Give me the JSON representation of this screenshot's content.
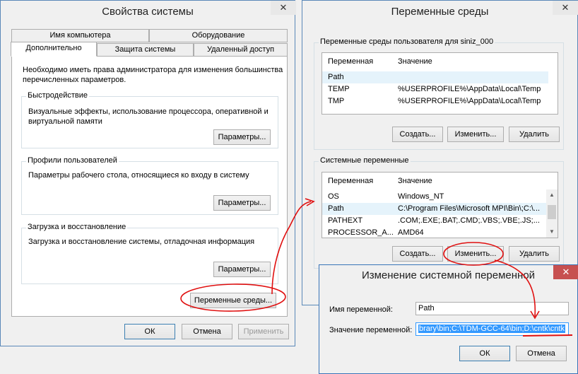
{
  "sysprops": {
    "title": "Свойства системы",
    "close_label": "✕",
    "tabs_row1": [
      "Имя компьютера",
      "Оборудование"
    ],
    "tabs_row2": [
      "Дополнительно",
      "Защита системы",
      "Удаленный доступ"
    ],
    "admin_note": "Необходимо иметь права администратора для изменения большинства перечисленных параметров.",
    "performance": {
      "title": "Быстродействие",
      "desc": "Визуальные эффекты, использование процессора, оперативной и виртуальной памяти",
      "button": "Параметры..."
    },
    "profiles": {
      "title": "Профили пользователей",
      "desc": "Параметры рабочего стола, относящиеся ко входу в систему",
      "button": "Параметры..."
    },
    "startup": {
      "title": "Загрузка и восстановление",
      "desc": "Загрузка и восстановление системы, отладочная информация",
      "button": "Параметры..."
    },
    "env_button": "Переменные среды...",
    "ok": "ОК",
    "cancel": "Отмена",
    "apply": "Применить"
  },
  "envvars": {
    "title": "Переменные среды",
    "close_label": "✕",
    "user_group_title": "Переменные среды пользователя для siniz_000",
    "col_var": "Переменная",
    "col_val": "Значение",
    "user_rows": [
      {
        "name": "Path",
        "value": ""
      },
      {
        "name": "TEMP",
        "value": "%USERPROFILE%\\AppData\\Local\\Temp"
      },
      {
        "name": "TMP",
        "value": "%USERPROFILE%\\AppData\\Local\\Temp"
      }
    ],
    "user_buttons": [
      "Создать...",
      "Изменить...",
      "Удалить"
    ],
    "sys_group_title": "Системные переменные",
    "sys_rows": [
      {
        "name": "OS",
        "value": "Windows_NT"
      },
      {
        "name": "Path",
        "value": "C:\\Program Files\\Microsoft MPI\\Bin\\;C:\\..."
      },
      {
        "name": "PATHEXT",
        "value": ".COM;.EXE;.BAT;.CMD;.VBS;.VBE;.JS;..."
      },
      {
        "name": "PROCESSOR_A...",
        "value": "AMD64"
      }
    ],
    "sys_buttons": [
      "Создать...",
      "Изменить...",
      "Удалить"
    ]
  },
  "editvar": {
    "title": "Изменение системной переменной",
    "close_label": "✕",
    "name_label": "Имя переменной:",
    "name_value": "Path",
    "value_label": "Значение переменной:",
    "value_value": "brary\\bin;C:\\TDM-GCC-64\\bin;D:\\cntk\\cntk",
    "ok": "ОК",
    "cancel": "Отмена"
  },
  "colors": {
    "annotation_red": "#e01010",
    "selection_blue": "#3399ff",
    "close_red": "#c75050"
  }
}
